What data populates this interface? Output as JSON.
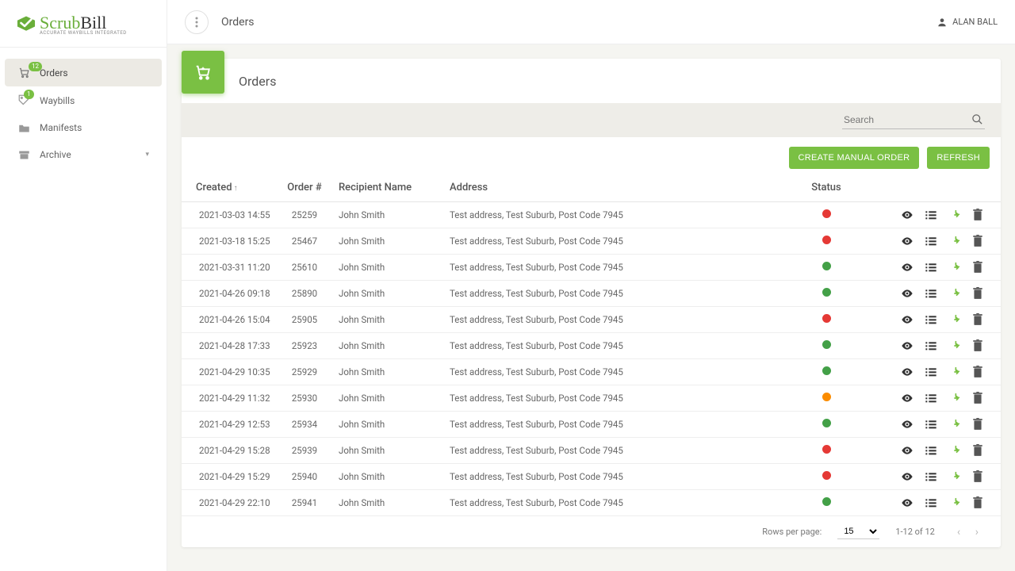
{
  "brand": {
    "name_a": "Scrub",
    "name_b": "Bill",
    "tagline": "ACCURATE WAYBILLS INTEGRATED"
  },
  "user": {
    "name": "ALAN BALL"
  },
  "topbar": {
    "title": "Orders"
  },
  "sidebar": {
    "items": [
      {
        "label": "Orders",
        "badge": "12"
      },
      {
        "label": "Waybills",
        "badge": "1"
      },
      {
        "label": "Manifests"
      },
      {
        "label": "Archive"
      }
    ]
  },
  "page": {
    "title": "Orders",
    "search_placeholder": "Search",
    "buttons": {
      "create": "CREATE MANUAL ORDER",
      "refresh": "REFRESH"
    }
  },
  "table": {
    "columns": {
      "created": "Created",
      "order": "Order #",
      "recipient": "Recipient Name",
      "address": "Address",
      "status": "Status"
    },
    "rows": [
      {
        "created": "2021-03-03 14:55",
        "order": "25259",
        "recipient": "John Smith",
        "address": "Test address, Test Suburb, Post Code 7945",
        "status": "red"
      },
      {
        "created": "2021-03-18 15:25",
        "order": "25467",
        "recipient": "John Smith",
        "address": "Test address, Test Suburb, Post Code 7945",
        "status": "red"
      },
      {
        "created": "2021-03-31 11:20",
        "order": "25610",
        "recipient": "John Smith",
        "address": "Test address, Test Suburb, Post Code 7945",
        "status": "green"
      },
      {
        "created": "2021-04-26 09:18",
        "order": "25890",
        "recipient": "John Smith",
        "address": "Test address, Test Suburb, Post Code 7945",
        "status": "green"
      },
      {
        "created": "2021-04-26 15:04",
        "order": "25905",
        "recipient": "John Smith",
        "address": "Test address, Test Suburb, Post Code 7945",
        "status": "red"
      },
      {
        "created": "2021-04-28 17:33",
        "order": "25923",
        "recipient": "John Smith",
        "address": "Test address, Test Suburb, Post Code 7945",
        "status": "green"
      },
      {
        "created": "2021-04-29 10:35",
        "order": "25929",
        "recipient": "John Smith",
        "address": "Test address, Test Suburb, Post Code 7945",
        "status": "green"
      },
      {
        "created": "2021-04-29 11:32",
        "order": "25930",
        "recipient": "John Smith",
        "address": "Test address, Test Suburb, Post Code 7945",
        "status": "orange"
      },
      {
        "created": "2021-04-29 12:53",
        "order": "25934",
        "recipient": "John Smith",
        "address": "Test address, Test Suburb, Post Code 7945",
        "status": "green"
      },
      {
        "created": "2021-04-29 15:28",
        "order": "25939",
        "recipient": "John Smith",
        "address": "Test address, Test Suburb, Post Code 7945",
        "status": "red"
      },
      {
        "created": "2021-04-29 15:29",
        "order": "25940",
        "recipient": "John Smith",
        "address": "Test address, Test Suburb, Post Code 7945",
        "status": "red"
      },
      {
        "created": "2021-04-29 22:10",
        "order": "25941",
        "recipient": "John Smith",
        "address": "Test address, Test Suburb, Post Code 7945",
        "status": "green"
      }
    ]
  },
  "pager": {
    "label": "Rows per page:",
    "size": "15",
    "range": "1-12 of 12"
  }
}
